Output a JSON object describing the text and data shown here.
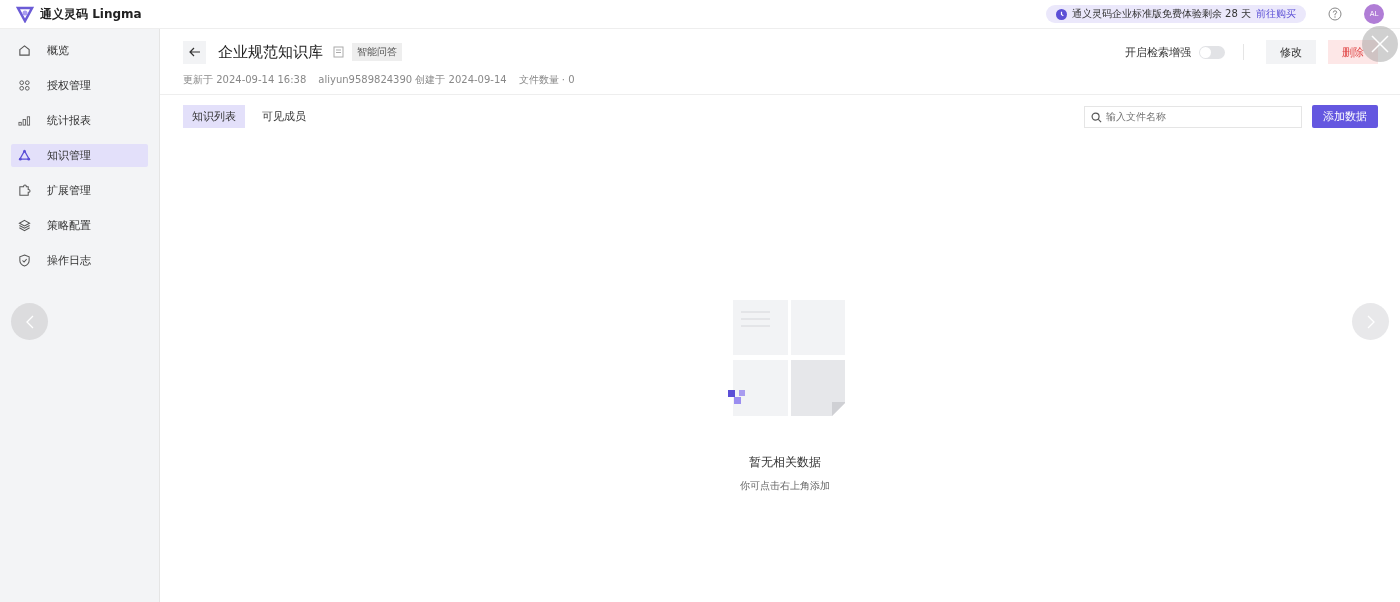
{
  "app": {
    "name": "通义灵码 Lingma"
  },
  "trial": {
    "text": "通义灵码企业标准版免费体验剩余 28 天",
    "link": "前往购买"
  },
  "user": {
    "initials": "AL"
  },
  "sidebar": {
    "items": [
      {
        "label": "概览",
        "selected": false
      },
      {
        "label": "授权管理",
        "selected": false
      },
      {
        "label": "统计报表",
        "selected": false
      },
      {
        "label": "知识管理",
        "selected": true
      },
      {
        "label": "扩展管理",
        "selected": false
      },
      {
        "label": "策略配置",
        "selected": false
      },
      {
        "label": "操作日志",
        "selected": false
      }
    ]
  },
  "header": {
    "title": "企业规范知识库",
    "tag": "智能问答",
    "updated": "更新于 2024-09-14 16:38",
    "created": "aliyun9589824390 创建于 2024-09-14",
    "file_count": "文件数量 · 0",
    "toggle": {
      "label": "开启检索增强",
      "on": false
    },
    "buttons": [
      "修改",
      "删除"
    ]
  },
  "tabs": [
    {
      "label": "知识列表",
      "selected": true
    },
    {
      "label": "可见成员",
      "selected": false
    }
  ],
  "search": {
    "placeholder": "输入文件名称"
  },
  "add_button": "添加数据",
  "empty": {
    "title": "暂无相关数据",
    "hint": "你可点击右上角添加"
  }
}
